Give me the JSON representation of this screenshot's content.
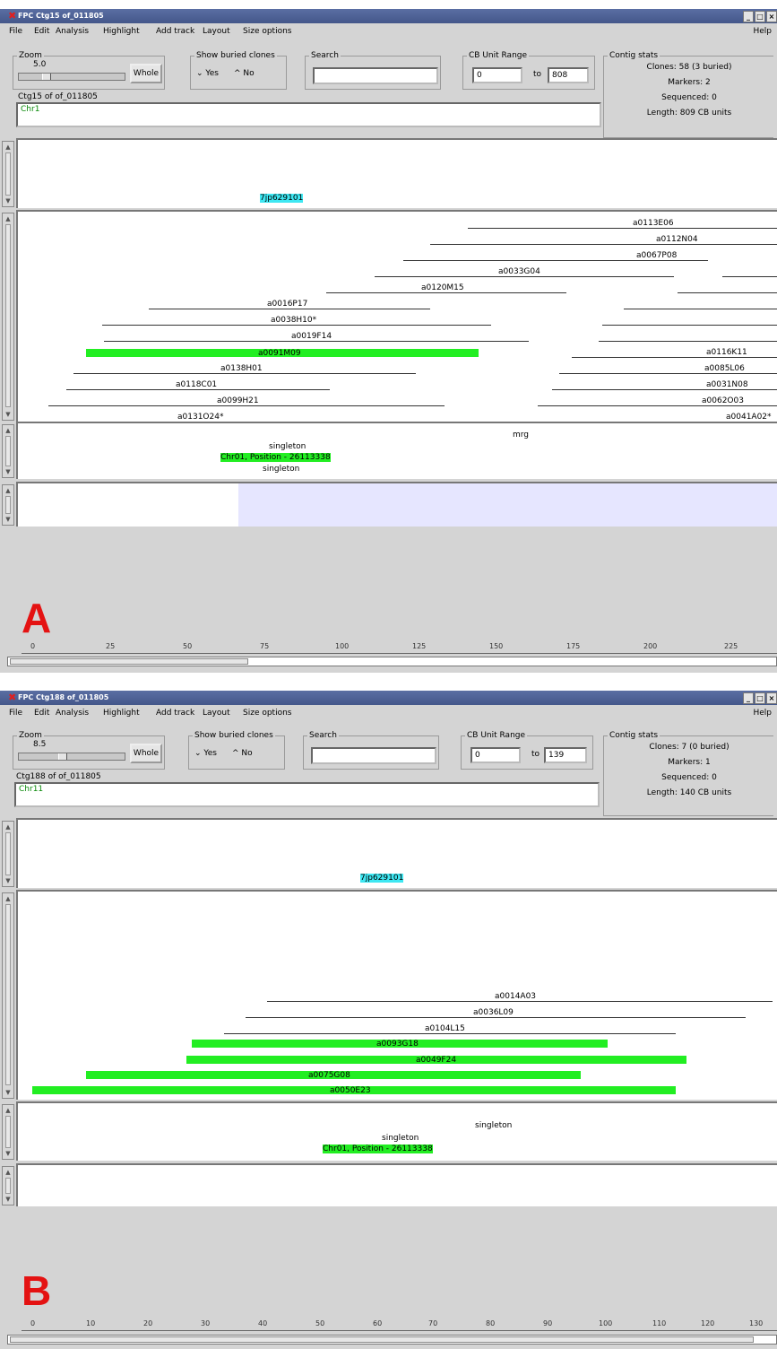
{
  "colors": {
    "accent_clone": "#22ee22",
    "marker_highlight": "#3ee7f2",
    "panel_shade": "#e6e6ff",
    "figure_letter": "#e41212"
  },
  "menu": [
    "File",
    "Edit",
    "Analysis",
    "Highlight",
    "Add track",
    "Layout",
    "Size options"
  ],
  "help": "Help",
  "icons": [
    "fpc-logo-icon",
    "minimize-icon",
    "maximize-icon",
    "close-icon"
  ],
  "windows": [
    {
      "title": "FPC Ctg15 of_011805",
      "zoom_label": "Zoom",
      "zoom": "5.0",
      "whole": "Whole",
      "buried_label": "Show buried clones",
      "yes": "Yes",
      "no": "No",
      "search_label": "Search",
      "search_value": "",
      "cb_label": "CB Unit Range",
      "cb_from": "0",
      "to": "to",
      "cb_to": "808",
      "stats_label": "Contig stats",
      "stats": [
        "Clones: 58 (3 buried)",
        "Markers: 2",
        "Sequenced: 0",
        "Length: 809 CB units"
      ],
      "ctg_label": "Ctg15 of of_011805",
      "ctg_text": "Chr1",
      "marker": "7jp629101",
      "clones": [
        "a0113E06",
        "a0112N04",
        "a0067P08",
        "a0033G04",
        "a0120M15",
        "a0016P17",
        "a0038H10*",
        "a0019F14",
        "a0091M09",
        "a0138H01",
        "a0118C01",
        "a0099H21",
        "a0131O24*",
        "a0116K11",
        "a0085L06",
        "a0031N08",
        "a0062O03",
        "a0041A02*"
      ],
      "seq_texts": [
        "mrg",
        "singleton",
        "Chr01, Position - 26113338",
        "singleton"
      ],
      "letter": "A",
      "ruler": [
        "0",
        "25",
        "50",
        "75",
        "100",
        "125",
        "150",
        "175",
        "200",
        "225"
      ]
    },
    {
      "title": "FPC Ctg188 of_011805",
      "zoom_label": "Zoom",
      "zoom": "8.5",
      "whole": "Whole",
      "buried_label": "Show buried clones",
      "yes": "Yes",
      "no": "No",
      "search_label": "Search",
      "search_value": "",
      "cb_label": "CB Unit Range",
      "cb_from": "0",
      "to": "to",
      "cb_to": "139",
      "stats_label": "Contig stats",
      "stats": [
        "Clones: 7 (0 buried)",
        "Markers: 1",
        "Sequenced: 0",
        "Length: 140 CB units"
      ],
      "ctg_label": "Ctg188 of of_011805",
      "ctg_text": "Chr11",
      "marker": "7jp629101",
      "clones": [
        "a0014A03",
        "a0036L09",
        "a0104L15",
        "a0093G18",
        "a0049F24",
        "a0075G08",
        "a0050E23"
      ],
      "seq_texts": [
        "singleton",
        "singleton",
        "Chr01, Position - 26113338"
      ],
      "letter": "B",
      "ruler": [
        "0",
        "10",
        "20",
        "30",
        "40",
        "50",
        "60",
        "70",
        "80",
        "90",
        "100",
        "110",
        "120",
        "130"
      ]
    }
  ]
}
